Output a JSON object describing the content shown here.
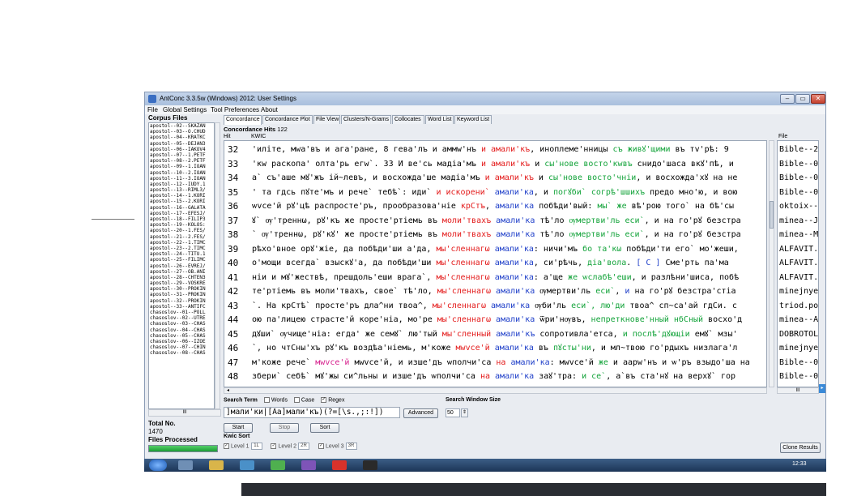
{
  "window": {
    "title": "AntConc 3.3.5w (Windows) 2012: User Settings",
    "controls": {
      "minimize": "–",
      "maximize": "▭",
      "close": "✕"
    }
  },
  "menu": [
    "File",
    "Global Settings",
    "Tool Preferences",
    "About"
  ],
  "corpus": {
    "title": "Corpus Files",
    "files": [
      "apostol--02--SKAZAN",
      "apostol--03--O.CHUD",
      "apostol--04--KRATKC",
      "apostol--05--DEJAN3",
      "apostol--06--IAKOV4",
      "apostol--07--1.PETF",
      "apostol--08--2.PETF",
      "apostol--09--1.IOAN",
      "apostol--10--2.IOAN",
      "apostol--11--3.IOAN",
      "apostol--12--IUDY.1",
      "apostol--13--RIML3/",
      "apostol--14--1.KORI",
      "apostol--15--2.KORI",
      "apostol--16--GALATA",
      "apostol--17--EFESJ/",
      "apostol--18--FILIP3",
      "apostol--19--KOLOS:",
      "apostol--20--1.FES/",
      "apostol--21--2.FES/",
      "apostol--22--1.TIMC",
      "apostol--23--2.TIMC",
      "apostol--24--TITU.1",
      "apostol--25--FILIMC",
      "apostol--26--EVREJ/",
      "apostol--27--OB.ANI",
      "apostol--28--CHTEN3",
      "apostol--29--VOSKRE",
      "apostol--30--PROKIN",
      "apostol--31--PROKIN",
      "apostol--32--PROKIN",
      "apostol--33--ANTIFC",
      "chasoslov--01--POLL",
      "chasoslov--02--UTRE",
      "chasoslov--03--CHAS",
      "chasoslov--04--CHAS",
      "chasoslov--05--CHAS",
      "chasoslov--06--IZOE",
      "chasoslov--07--CHIN",
      "chasoslov--08--CHAS"
    ],
    "scroll_label": "III",
    "total_label": "Total No.",
    "total_value": "1470",
    "processed_label": "Files Processed",
    "processed_fraction": 1.0
  },
  "tabs": [
    {
      "label": "Concordance",
      "active": true
    },
    {
      "label": "Concordance Plot",
      "active": false
    },
    {
      "label": "File View",
      "active": false
    },
    {
      "label": "Clusters/N-Grams",
      "active": false
    },
    {
      "label": "Collocates",
      "active": false
    },
    {
      "label": "Word List",
      "active": false
    },
    {
      "label": "Keyword List",
      "active": false
    }
  ],
  "concordance": {
    "hits_label": "Concordance Hits",
    "hits_value": "122",
    "hit_header": "Hit",
    "kwic_header": "KWIC",
    "file_header": "File",
    "rows": [
      {
        "hit": "32",
        "file": "Bible--22",
        "segments": [
          {
            "t": "'иліте, мwа'въ и ага'ране,  8 гева'лъ и аммw'нъ ",
            "c": ""
          },
          {
            "t": "и амали'къ",
            "c": "red"
          },
          {
            "t": ", иноплеме'нницы ",
            "c": ""
          },
          {
            "t": "съ живꙋ'щими",
            "c": "green"
          },
          {
            "t": " въ тv'рѣ:  9",
            "c": ""
          }
        ]
      },
      {
        "hit": "33",
        "file": "Bible--07",
        "segments": [
          {
            "t": "'кw раскопа' олта'рь егw`.  33 И ве'сь мадіа'мъ ",
            "c": ""
          },
          {
            "t": "и амали'къ",
            "c": "red"
          },
          {
            "t": " и ",
            "c": ""
          },
          {
            "t": "сы'нове восто'кwвъ",
            "c": "green"
          },
          {
            "t": " снидо'шаса вкꙋ'пѣ, и",
            "c": ""
          }
        ]
      },
      {
        "hit": "34",
        "file": "Bible--07",
        "segments": [
          {
            "t": "а` съ'аше мꙋ'жъ ій~левъ, и восхожда'ше мадіа'мъ ",
            "c": ""
          },
          {
            "t": "и амали'къ",
            "c": "red"
          },
          {
            "t": " и ",
            "c": ""
          },
          {
            "t": "сы'нове восто'чніи",
            "c": "green"
          },
          {
            "t": ", и восхожда'хꙋ на не",
            "c": ""
          }
        ]
      },
      {
        "hit": "35",
        "file": "Bible--09",
        "segments": [
          {
            "t": "' та гдсь пꙋте'мъ и рече` тебѣ`: иди` ",
            "c": ""
          },
          {
            "t": "и искорени`",
            "c": "red"
          },
          {
            "t": " ",
            "c": ""
          },
          {
            "t": "амали'ка",
            "c": "blue"
          },
          {
            "t": ", и ",
            "c": ""
          },
          {
            "t": "погꙋби` согрѣ'шшихъ",
            "c": "green"
          },
          {
            "t": " предо мно'ю, и вою",
            "c": ""
          }
        ]
      },
      {
        "hit": "36",
        "file": "oktoix--(",
        "segments": [
          {
            "t": "ѡvсе'й рꙋ'цѣ распросте'ръ, прообразова'ніе ",
            "c": ""
          },
          {
            "t": "крСтъ",
            "c": "red"
          },
          {
            "t": ", ",
            "c": ""
          },
          {
            "t": "амали'ка",
            "c": "blue"
          },
          {
            "t": " побѣди'вый: ",
            "c": ""
          },
          {
            "t": "мы` же",
            "c": "green"
          },
          {
            "t": " вѣ'рою того` на бѣ'сы",
            "c": ""
          }
        ]
      },
      {
        "hit": "37",
        "file": "minea--J/",
        "segments": [
          {
            "t": "ꙋ` ѹ'треннω, рꙋ'къ же просте'ртіемь въ ",
            "c": ""
          },
          {
            "t": "моли'твахъ",
            "c": "red"
          },
          {
            "t": " ",
            "c": ""
          },
          {
            "t": "амали'ка",
            "c": "blue"
          },
          {
            "t": " тѣ'ло ",
            "c": ""
          },
          {
            "t": "ѹмертви'ль еси`",
            "c": "green"
          },
          {
            "t": ", и на го'рꙋ безстра",
            "c": ""
          }
        ]
      },
      {
        "hit": "38",
        "file": "minea--M/",
        "segments": [
          {
            "t": "` ѹ'треннω, рꙋ'кꙋ' же просте'ртіемь въ ",
            "c": ""
          },
          {
            "t": "моли'твахъ",
            "c": "red"
          },
          {
            "t": " ",
            "c": ""
          },
          {
            "t": "амали'ка",
            "c": "blue"
          },
          {
            "t": " тѣ'ло ",
            "c": ""
          },
          {
            "t": "ѹмертви'ль еси`",
            "c": "green"
          },
          {
            "t": ", и на го'рꙋ безстра",
            "c": ""
          }
        ]
      },
      {
        "hit": "39",
        "file": "ALFAVIT.D",
        "segments": [
          {
            "t": "рѣхо'вное орꙋ'жіе, да побѣди'ши а'да, ",
            "c": ""
          },
          {
            "t": "мы'сленнагω",
            "c": "red"
          },
          {
            "t": " ",
            "c": ""
          },
          {
            "t": "амали'ка",
            "c": "blue"
          },
          {
            "t": ": ничи'мъ ",
            "c": ""
          },
          {
            "t": "бо та'кω",
            "c": "green"
          },
          {
            "t": " побѣди'ти его` мо'жеши,",
            "c": ""
          }
        ]
      },
      {
        "hit": "40",
        "file": "ALFAVIT.D",
        "segments": [
          {
            "t": "о'мощи всегда` взыскꙋ'а, да побѣди'ши ",
            "c": ""
          },
          {
            "t": "мы'сленнагω",
            "c": "red"
          },
          {
            "t": " ",
            "c": ""
          },
          {
            "t": "амали'ка",
            "c": "blue"
          },
          {
            "t": ", си'рѣчь, ",
            "c": ""
          },
          {
            "t": "діа'вола",
            "c": "green"
          },
          {
            "t": ".  ",
            "c": ""
          },
          {
            "t": "[ С ]",
            "c": "blue"
          },
          {
            "t": " Сме'рть па'ма",
            "c": ""
          }
        ]
      },
      {
        "hit": "41",
        "file": "ALFAVIT.D",
        "segments": [
          {
            "t": "ніи и мꙋ'жествѣ, прешдоль'еши врага`, ",
            "c": ""
          },
          {
            "t": "мы'сленнагω",
            "c": "red"
          },
          {
            "t": " ",
            "c": ""
          },
          {
            "t": "амали'ка",
            "c": "blue"
          },
          {
            "t": ": а'ще ",
            "c": ""
          },
          {
            "t": "же ѡслабѣ'еши",
            "c": "green"
          },
          {
            "t": ", и разлѣни'шиса, побѣ",
            "c": ""
          }
        ]
      },
      {
        "hit": "42",
        "file": "minejnye.",
        "segments": [
          {
            "t": "те'ртіемь въ моли'твахъ, свое` тѣ'ло, ",
            "c": ""
          },
          {
            "t": "мы'сленнагω",
            "c": "red"
          },
          {
            "t": " ",
            "c": ""
          },
          {
            "t": "амали'ка",
            "c": "blue"
          },
          {
            "t": " ѹмертви'ль ",
            "c": ""
          },
          {
            "t": "еси`",
            "c": "green"
          },
          {
            "t": ", ",
            "c": ""
          },
          {
            "t": "и",
            "c": "blue"
          },
          {
            "t": " на го'рꙋ безстра'стіа",
            "c": ""
          }
        ]
      },
      {
        "hit": "43",
        "file": "triod.pos",
        "segments": [
          {
            "t": "`.  На крСтѣ` просте'ръ дла^ни твоа^, ",
            "c": ""
          },
          {
            "t": "мы'сленнагω",
            "c": "red"
          },
          {
            "t": " ",
            "c": ""
          },
          {
            "t": "амали'ка",
            "c": "blue"
          },
          {
            "t": " ѹби'ль ",
            "c": ""
          },
          {
            "t": "еси`, лю'ди",
            "c": "green"
          },
          {
            "t": " твоа^ сп~са'ай гдСи. с",
            "c": ""
          }
        ]
      },
      {
        "hit": "44",
        "file": "minea--AV",
        "segments": [
          {
            "t": "ою па'лицею страсте'й коре'ніа, мо'ре ",
            "c": ""
          },
          {
            "t": "мы'сленнагω",
            "c": "red"
          },
          {
            "t": " ",
            "c": ""
          },
          {
            "t": "амали'ка",
            "c": "blue"
          },
          {
            "t": " ѿри'нѹвъ, ",
            "c": ""
          },
          {
            "t": "непреткнове'нный нбСный",
            "c": "green"
          },
          {
            "t": " восхо'д",
            "c": ""
          }
        ]
      },
      {
        "hit": "45",
        "file": "DOBROTOLL",
        "segments": [
          {
            "t": "дꙋши` ѹчище'ніа: егда' же семꙋ` лю'тый ",
            "c": ""
          },
          {
            "t": "мы'сленный",
            "c": "red"
          },
          {
            "t": " ",
            "c": ""
          },
          {
            "t": "амали'къ",
            "c": "blue"
          },
          {
            "t": " сопротивла'етса, ",
            "c": ""
          },
          {
            "t": "и послѣ'дꙋющіи",
            "c": "green"
          },
          {
            "t": " емꙋ` мзы'",
            "c": ""
          }
        ]
      },
      {
        "hit": "46",
        "file": "minejnye.",
        "segments": [
          {
            "t": "`, но чтСны'хъ рꙋ'къ воздѣа'ніемь, м'коже ",
            "c": ""
          },
          {
            "t": "мwvсе'й",
            "c": "red"
          },
          {
            "t": " ",
            "c": ""
          },
          {
            "t": "амали'ка",
            "c": "blue"
          },
          {
            "t": " въ ",
            "c": ""
          },
          {
            "t": "пꙋсты'ни",
            "c": "green"
          },
          {
            "t": ", и мл~твою го'рдыхъ низлага'л",
            "c": ""
          }
        ]
      },
      {
        "hit": "47",
        "file": "Bible--02",
        "segments": [
          {
            "t": "м'коже рече` ",
            "c": ""
          },
          {
            "t": "мwvсе'й",
            "c": "pink"
          },
          {
            "t": " мwvсе'й, и изше'дъ ѡполчи'са ",
            "c": ""
          },
          {
            "t": "на",
            "c": "red"
          },
          {
            "t": " ",
            "c": ""
          },
          {
            "t": "амали'ка",
            "c": "blue"
          },
          {
            "t": ": мwvсе'й ",
            "c": ""
          },
          {
            "t": "же",
            "c": "green"
          },
          {
            "t": " и аарw'нъ и ѡ'ръ взыдо'ша на",
            "c": ""
          }
        ]
      },
      {
        "hit": "48",
        "file": "Bible--02",
        "segments": [
          {
            "t": "збери` себѣ` мꙋ'жы си^льны и изше'дъ ѡполчи'са ",
            "c": ""
          },
          {
            "t": "на",
            "c": "red"
          },
          {
            "t": " ",
            "c": ""
          },
          {
            "t": "амали'ка",
            "c": "blue"
          },
          {
            "t": " заꙋ'тра: ",
            "c": ""
          },
          {
            "t": "и се`",
            "c": "green"
          },
          {
            "t": ", а`въ ста'нꙋ на верхꙋ` гор",
            "c": ""
          }
        ]
      },
      {
        "hit": "49",
        "file": "Bible--02",
        "segments": [
          {
            "t": "ще мое`:  16 м'кw рꙋко'ю та'йною ра'тꙋеть гдСь ",
            "c": ""
          },
          {
            "t": "на",
            "c": "red"
          },
          {
            "t": " ",
            "c": ""
          },
          {
            "t": "амали'ка",
            "c": "blue"
          },
          {
            "t": " ",
            "c": ""
          },
          {
            "t": "ѿ ро'да въ",
            "c": "green"
          },
          {
            "t": " ро'дъ.  Глава` 18.  1 ѹслы'ша",
            "c": ""
          }
        ]
      }
    ],
    "hscroll_left": "◂",
    "file_scroll": "III",
    "file_scroll_right": "▸"
  },
  "search": {
    "term_label": "Search Term",
    "words_label": "Words",
    "case_label": "Case",
    "regex_label": "Regex",
    "regex_checked": "✓",
    "window_size_label": "Search Window Size",
    "query": "]мали'ки|[Аа]мали'къ)(?=[\\s.,;:!])",
    "advanced_label": "Advanced",
    "window_size_value": "50",
    "spin_symbol": "⇕",
    "start_label": "Start",
    "stop_label": "Stop",
    "sort_label": "Sort"
  },
  "kwic_sort": {
    "label": "Kwic Sort",
    "levels": [
      {
        "label": "Level 1",
        "value": "1L"
      },
      {
        "label": "Level 2",
        "value": "2R"
      },
      {
        "label": "Level 3",
        "value": "3R"
      }
    ],
    "clone_label": "Clone Results"
  },
  "taskbar": {
    "clock": "12:33"
  },
  "colors": {
    "red": "#e31a1a",
    "blue": "#1f3fc9",
    "green": "#13a33a",
    "pink": "#d61e8c",
    "progress": "#1c9c34"
  }
}
